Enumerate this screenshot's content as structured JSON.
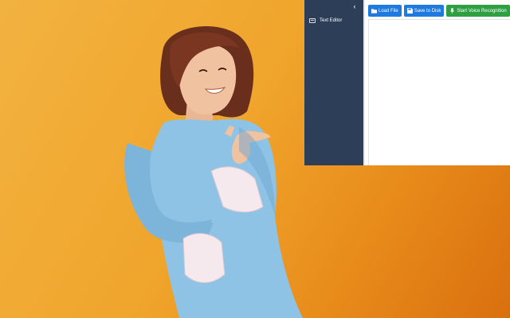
{
  "background": {
    "subject": "woman in light blue dress pointing right on orange background",
    "colors": {
      "backdrop": "#f0a52c",
      "dress": "#8ec3e6",
      "hair": "#6a2e1c",
      "skin": "#f0c2a0"
    }
  },
  "sidebar": {
    "collapse_icon": "chevron-left-icon",
    "items": [
      {
        "label": "Text Editor",
        "icon": "keyboard-icon"
      }
    ]
  },
  "toolbar": {
    "load_label": "Load File",
    "load_icon": "folder-open-icon",
    "save_label": "Save to Disk",
    "save_icon": "save-icon",
    "voice_label": "Start Voice Recognition",
    "voice_icon": "microphone-icon"
  },
  "editor": {
    "content": ""
  },
  "colors": {
    "sidebar_bg": "#2c3e58",
    "primary": "#1f7ae0",
    "success": "#2ea043"
  }
}
